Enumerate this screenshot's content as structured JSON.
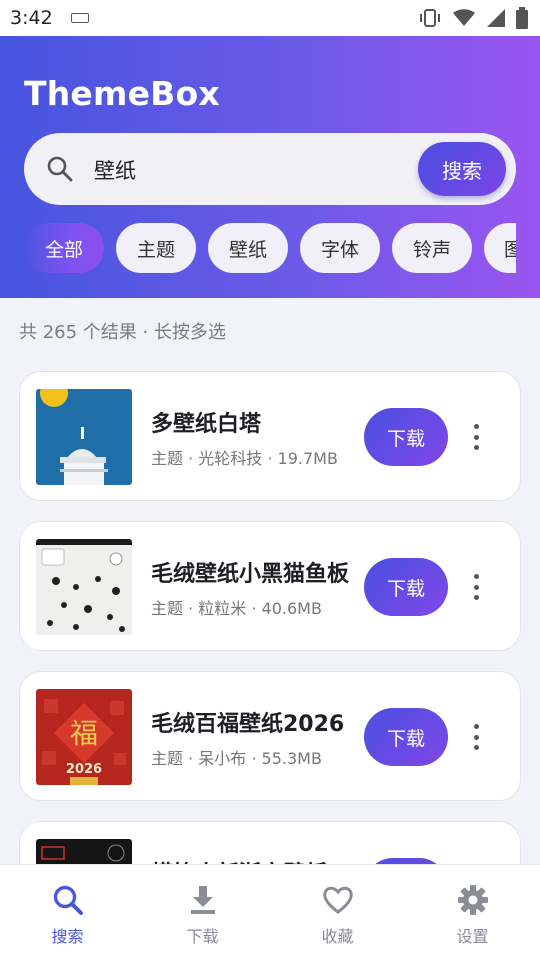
{
  "status": {
    "time": "3:42"
  },
  "app": {
    "title": "ThemeBox"
  },
  "search": {
    "value": "壁纸",
    "button": "搜索"
  },
  "categories": [
    "全部",
    "主题",
    "壁纸",
    "字体",
    "铃声",
    "图"
  ],
  "results_summary": "共 265 个结果 · 长按多选",
  "items": [
    {
      "title": "多壁纸白塔",
      "meta": "主题 · 光轮科技 · 19.7MB",
      "action": "下载"
    },
    {
      "title": "毛绒壁纸小黑猫鱼板",
      "meta": "主题 · 粒粒米 · 40.6MB",
      "action": "下载"
    },
    {
      "title": "毛绒百福壁纸2026",
      "meta": "主题 · 呆小布 · 55.3MB",
      "action": "下载"
    },
    {
      "title": "横笔小新浙商壁纸",
      "meta": "",
      "action": "下载"
    }
  ],
  "thumb_text": {
    "fu": "福",
    "year": "2026"
  },
  "nav": [
    {
      "label": "搜索",
      "icon": "search-icon"
    },
    {
      "label": "下载",
      "icon": "download-icon"
    },
    {
      "label": "收藏",
      "icon": "heart-icon"
    },
    {
      "label": "设置",
      "icon": "gear-icon"
    }
  ],
  "colors": {
    "accent": "#4a56e0",
    "gradient_start": "#4655de",
    "gradient_end": "#9a55f0"
  }
}
